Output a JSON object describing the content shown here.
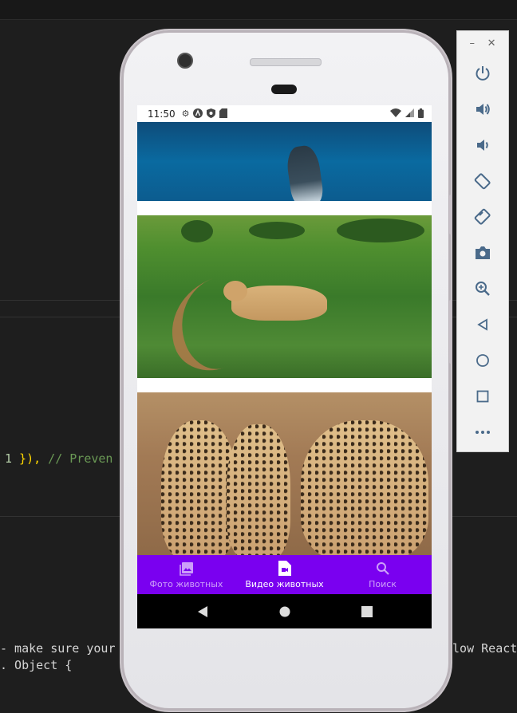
{
  "code": {
    "line1_num": "1",
    "line1_punct": " }),",
    "line1_comment": " // Preven",
    "line2_left": "- make sure your",
    "line2_right": "llow React",
    "line3_left": ". Object {"
  },
  "status_bar": {
    "time": "11:50"
  },
  "bottom_nav": {
    "items": [
      {
        "label": "Фото животных",
        "icon": "image-icon",
        "active": false
      },
      {
        "label": "Видео животных",
        "icon": "video-file-icon",
        "active": true
      },
      {
        "label": "Поиск",
        "icon": "search-icon",
        "active": false
      }
    ]
  },
  "videos": [
    {
      "subject": "ocean-whale"
    },
    {
      "subject": "lioness"
    },
    {
      "subject": "cheetahs"
    }
  ],
  "colors": {
    "bottom_nav_bg": "#7a00f0",
    "ide_bg": "#1e1e1e"
  },
  "emulator_toolbar": {
    "icons": [
      "power-icon",
      "volume-up-icon",
      "volume-down-icon",
      "rotate-left-icon",
      "rotate-right-icon",
      "camera-icon",
      "zoom-icon",
      "back-icon",
      "home-icon",
      "overview-icon",
      "more-icon"
    ]
  }
}
